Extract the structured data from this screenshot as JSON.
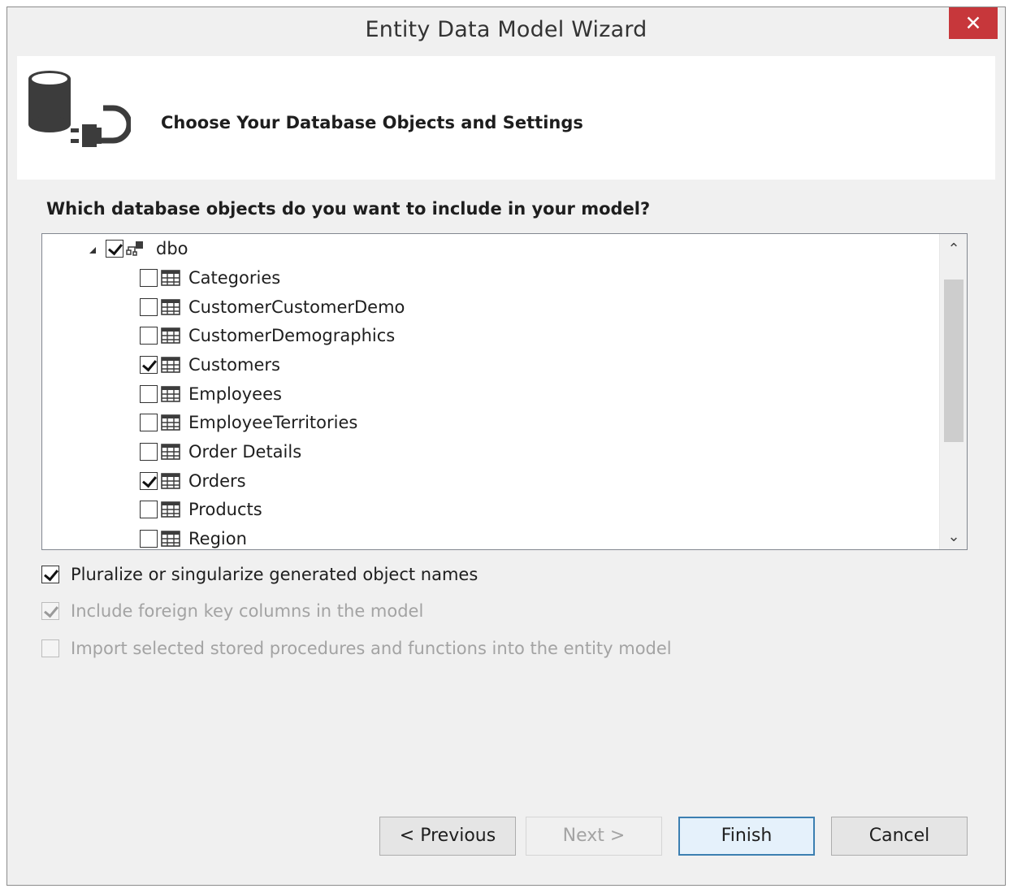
{
  "window": {
    "title": "Entity Data Model Wizard",
    "close_label": "✕"
  },
  "header": {
    "title": "Choose Your Database Objects and Settings",
    "icon": "database-plug-icon"
  },
  "question": "Which database objects do you want to include in your model?",
  "tree": {
    "schema": {
      "label": "dbo",
      "checked": true,
      "expanded": true
    },
    "tables": [
      {
        "label": "Categories",
        "checked": false
      },
      {
        "label": "CustomerCustomerDemo",
        "checked": false
      },
      {
        "label": "CustomerDemographics",
        "checked": false
      },
      {
        "label": "Customers",
        "checked": true
      },
      {
        "label": "Employees",
        "checked": false
      },
      {
        "label": "EmployeeTerritories",
        "checked": false
      },
      {
        "label": "Order Details",
        "checked": false
      },
      {
        "label": "Orders",
        "checked": true
      },
      {
        "label": "Products",
        "checked": false
      },
      {
        "label": "Region",
        "checked": false
      }
    ],
    "scroll_up": "⌃",
    "scroll_down": "⌄"
  },
  "options": [
    {
      "label": "Pluralize or singularize generated object names",
      "checked": true,
      "enabled": true
    },
    {
      "label": "Include foreign key columns in the model",
      "checked": true,
      "enabled": false
    },
    {
      "label": "Import selected stored procedures and functions into the entity model",
      "checked": false,
      "enabled": false
    }
  ],
  "buttons": {
    "previous": "< Previous",
    "next": "Next >",
    "finish": "Finish",
    "cancel": "Cancel"
  },
  "colors": {
    "close_button": "#c7373b",
    "default_button_border": "#3c7fb1",
    "disabled_text": "#a3a3a3"
  }
}
